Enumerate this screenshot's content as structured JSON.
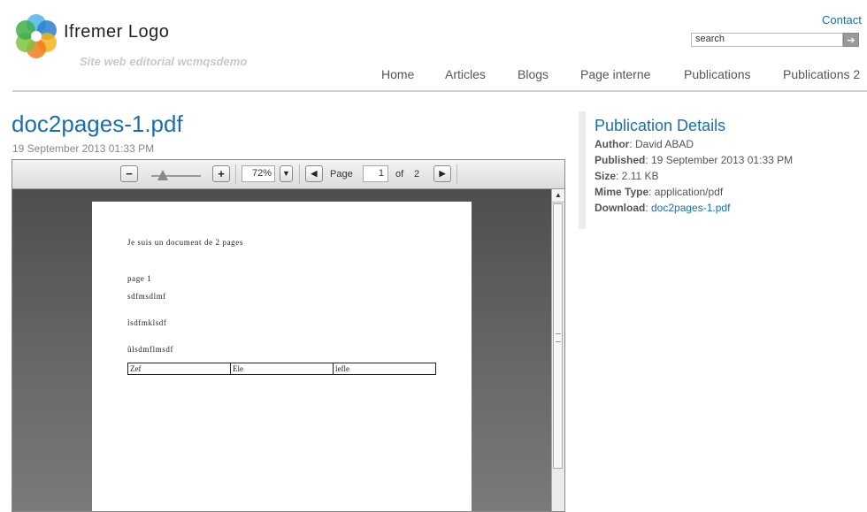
{
  "header": {
    "logo_text": "Ifremer Logo",
    "site_subtitle": "Site web editorial wcmqsdemo",
    "contact_label": "Contact",
    "search_value": "search",
    "search_button": "➔"
  },
  "nav": {
    "items": [
      "Home",
      "Articles",
      "Blogs",
      "Page interne",
      "Publications",
      "Publications 2"
    ]
  },
  "document": {
    "title": "doc2pages-1.pdf",
    "date": "19 September 2013 01:33 PM"
  },
  "viewer": {
    "zoom_out": "−",
    "zoom_in": "+",
    "zoom_level": "72%",
    "zoom_level_fraction": 0.72,
    "page_label": "Page",
    "current_page": "1",
    "of_label": "of",
    "total_pages": "2",
    "page_content": {
      "line1": "Je suis un document de  2 pages",
      "line2": "page 1",
      "line3": "sdfmsdlmf",
      "line4": "lsdfmklsdf",
      "line5": "ûlsdmflmsdf",
      "table_cells": [
        "Zef",
        "Ele",
        "lefle"
      ]
    }
  },
  "details": {
    "heading": "Publication Details",
    "author_label": "Author",
    "author_value": ": David ABAD",
    "published_label": "Published",
    "published_value": ": 19 September 2013 01:33 PM",
    "size_label": "Size",
    "size_value": ": 2.11 KB",
    "mime_label": "Mime Type",
    "mime_value": ": application/pdf",
    "download_label": "Download",
    "download_sep": ": ",
    "download_link": "doc2pages-1.pdf"
  },
  "colors": {
    "link": "#1a6fb0",
    "viewer_background": "#5a5a5a"
  }
}
